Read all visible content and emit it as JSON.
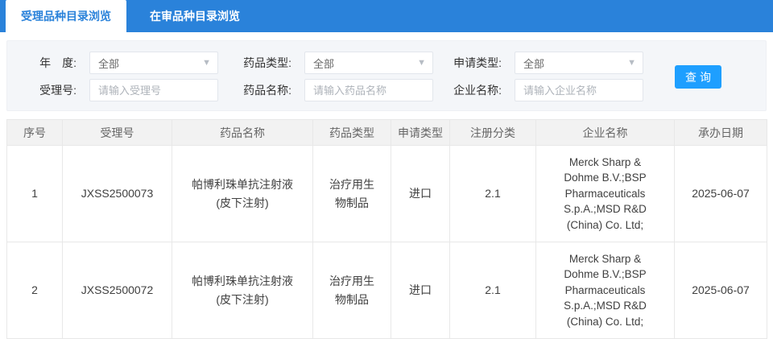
{
  "tabs": [
    {
      "label": "受理品种目录浏览",
      "active": true
    },
    {
      "label": "在审品种目录浏览",
      "active": false
    }
  ],
  "filters": {
    "year": {
      "label": "年　度:",
      "value": "全部"
    },
    "drug_type": {
      "label": "药品类型:",
      "value": "全部"
    },
    "apply_type": {
      "label": "申请类型:",
      "value": "全部"
    },
    "accept_no": {
      "label": "受理号:",
      "placeholder": "请输入受理号"
    },
    "drug_name": {
      "label": "药品名称:",
      "placeholder": "请输入药品名称"
    },
    "company": {
      "label": "企业名称:",
      "placeholder": "请输入企业名称"
    },
    "search_label": "查询"
  },
  "table": {
    "headers": [
      "序号",
      "受理号",
      "药品名称",
      "药品类型",
      "申请类型",
      "注册分类",
      "企业名称",
      "承办日期"
    ],
    "rows": [
      {
        "no": "1",
        "acceptance_no": "JXSS2500073",
        "drug_name": "帕博利珠单抗注射液\n(皮下注射)",
        "drug_type": "治疗用生\n物制品",
        "apply_type": "进口",
        "reg_class": "2.1",
        "company": "Merck Sharp & Dohme B.V.;BSP Pharmaceuticals S.p.A.;MSD R&D (China) Co. Ltd;",
        "date": "2025-06-07"
      },
      {
        "no": "2",
        "acceptance_no": "JXSS2500072",
        "drug_name": "帕博利珠单抗注射液\n(皮下注射)",
        "drug_type": "治疗用生\n物制品",
        "apply_type": "进口",
        "reg_class": "2.1",
        "company": "Merck Sharp & Dohme B.V.;BSP Pharmaceuticals S.p.A.;MSD R&D (China) Co. Ltd;",
        "date": "2025-06-07"
      }
    ]
  },
  "colors": {
    "bar_blue": "#2a82da",
    "button_blue": "#1e9fff",
    "panel_bg": "#f4f6f9",
    "table_border": "#e8e8e8"
  }
}
